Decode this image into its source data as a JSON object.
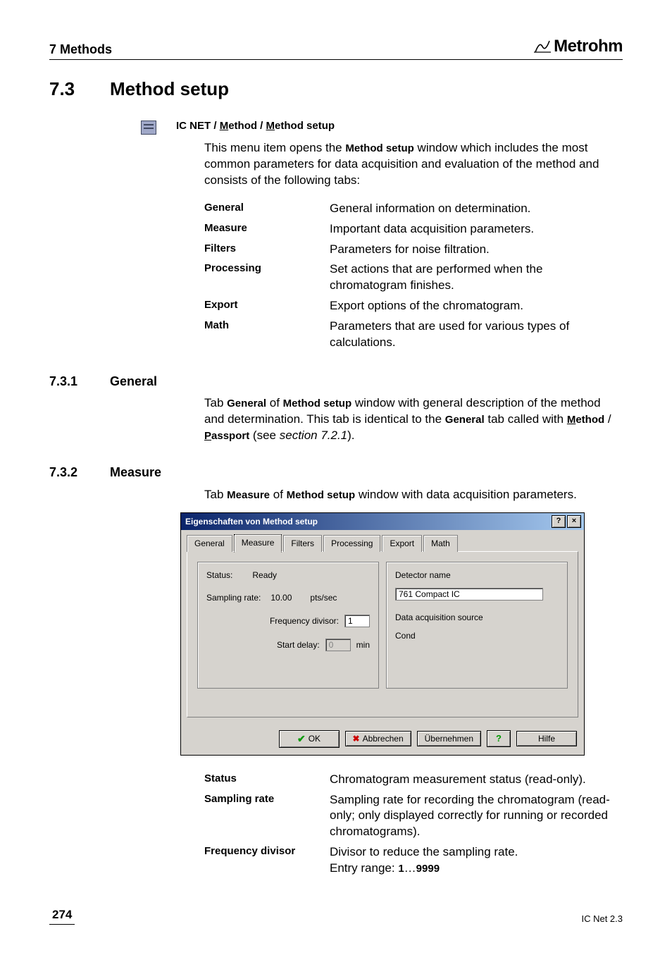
{
  "header": {
    "chapter": "7 Methods",
    "brand": "Metrohm"
  },
  "section": {
    "num": "7.3",
    "title": "Method setup"
  },
  "breadcrumb": {
    "app": "IC NET",
    "part1": "ethod",
    "part2": "ethod setup",
    "m": "M"
  },
  "intro": "This menu item opens the Method setup window which includes the most common parameters for data acquisition and evaluation of the method and consists of the following tabs:",
  "tabs_table": [
    {
      "k": "General",
      "v": "General information on determination."
    },
    {
      "k": "Measure",
      "v": "Important data acquisition parameters."
    },
    {
      "k": "Filters",
      "v": "Parameters for noise filtration."
    },
    {
      "k": "Processing",
      "v": "Set actions that are performed when the chromatogram finishes."
    },
    {
      "k": "Export",
      "v": "Export options of the chromatogram."
    },
    {
      "k": "Math",
      "v": "Parameters that are used for various types of calculations."
    }
  ],
  "sub1": {
    "num": "7.3.1",
    "title": "General"
  },
  "sub1_text": {
    "pre": "Tab ",
    "b1": "General",
    "mid1": " of ",
    "b2": "Method setup",
    "mid2": " window with general description of the method and determination. This tab is identical to the ",
    "b3": "General",
    "mid3": " tab called with ",
    "m4a": "ethod",
    "sep": " / ",
    "m4b": "assport",
    "post": " (see ",
    "it": "section 7.2.1",
    "end": ")."
  },
  "sub2": {
    "num": "7.3.2",
    "title": "Measure"
  },
  "sub2_text": {
    "pre": "Tab ",
    "b1": "Measure",
    "mid1": " of ",
    "b2": "Method setup",
    "post": " window with data acquisition parameters."
  },
  "dialog": {
    "title": "Eigenschaften von Method setup",
    "help_btn": "?",
    "close_btn": "×",
    "tabs": [
      "General",
      "Measure",
      "Filters",
      "Processing",
      "Export",
      "Math"
    ],
    "active_tab": 1,
    "left": {
      "status_label": "Status:",
      "status_value": "Ready",
      "sampling_label": "Sampling rate:",
      "sampling_value": "10.00",
      "sampling_unit": "pts/sec",
      "freq_label": "Frequency divisor:",
      "freq_value": "1",
      "delay_label": "Start delay:",
      "delay_value": "0",
      "delay_unit": "min"
    },
    "right": {
      "det_label": "Detector name",
      "det_value": "761 Compact IC",
      "daq_label": "Data acquisition source",
      "daq_value": "Cond"
    },
    "buttons": {
      "ok": "OK",
      "cancel": "Abbrechen",
      "apply": "Übernehmen",
      "help": "Hilfe"
    }
  },
  "fields_table": [
    {
      "k": "Status",
      "v": "Chromatogram measurement status (read-only)."
    },
    {
      "k": "Sampling rate",
      "v": "Sampling rate for recording the chromatogram (read-only; only displayed correctly for running or recorded chromatograms)."
    }
  ],
  "freq_row": {
    "k": "Frequency divisor",
    "v1": "Divisor to reduce the sampling rate.",
    "v2a": "Entry range:  ",
    "v2b": "1",
    "v2c": "…",
    "v2d": "9999"
  },
  "footer": {
    "page": "274",
    "product": "IC Net 2.3"
  }
}
